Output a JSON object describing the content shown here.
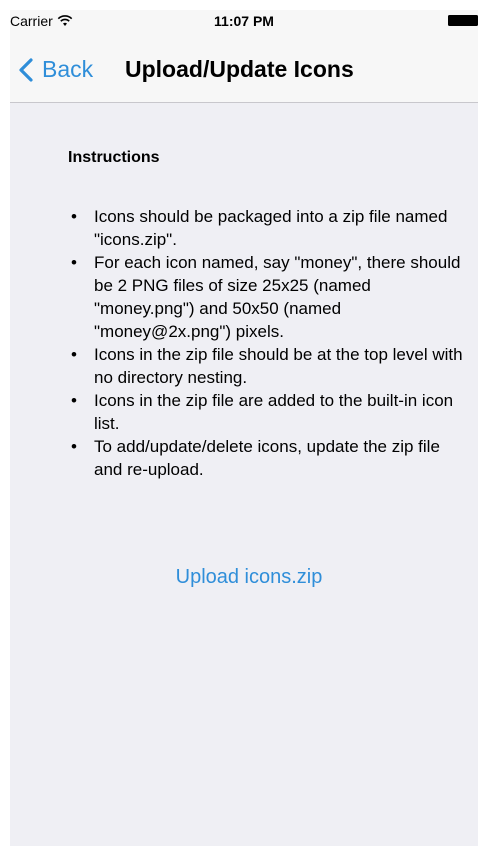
{
  "status_bar": {
    "carrier": "Carrier",
    "time": "11:07 PM",
    "wifi_icon": "wifi-icon",
    "battery_icon": "battery-icon"
  },
  "nav_bar": {
    "back_label": "Back",
    "title": "Upload/Update Icons",
    "back_icon": "chevron-left-icon"
  },
  "content": {
    "heading": "Instructions",
    "bullet": "•",
    "items": [
      "Icons should be packaged into a zip file named \"icons.zip\".",
      "For each icon named, say \"money\", there should be 2 PNG files of size 25x25 (named \"money.png\") and 50x50 (named \"money@2x.png\") pixels.",
      "Icons in the zip file should be at the top level with no directory nesting.",
      "Icons in the zip file are added to the built-in icon list.",
      "To add/update/delete icons, update the zip file and re-upload."
    ],
    "upload_label": "Upload icons.zip"
  },
  "colors": {
    "accent": "#2f8ed9",
    "background": "#efeff4",
    "bar_background": "#f7f7f7"
  }
}
